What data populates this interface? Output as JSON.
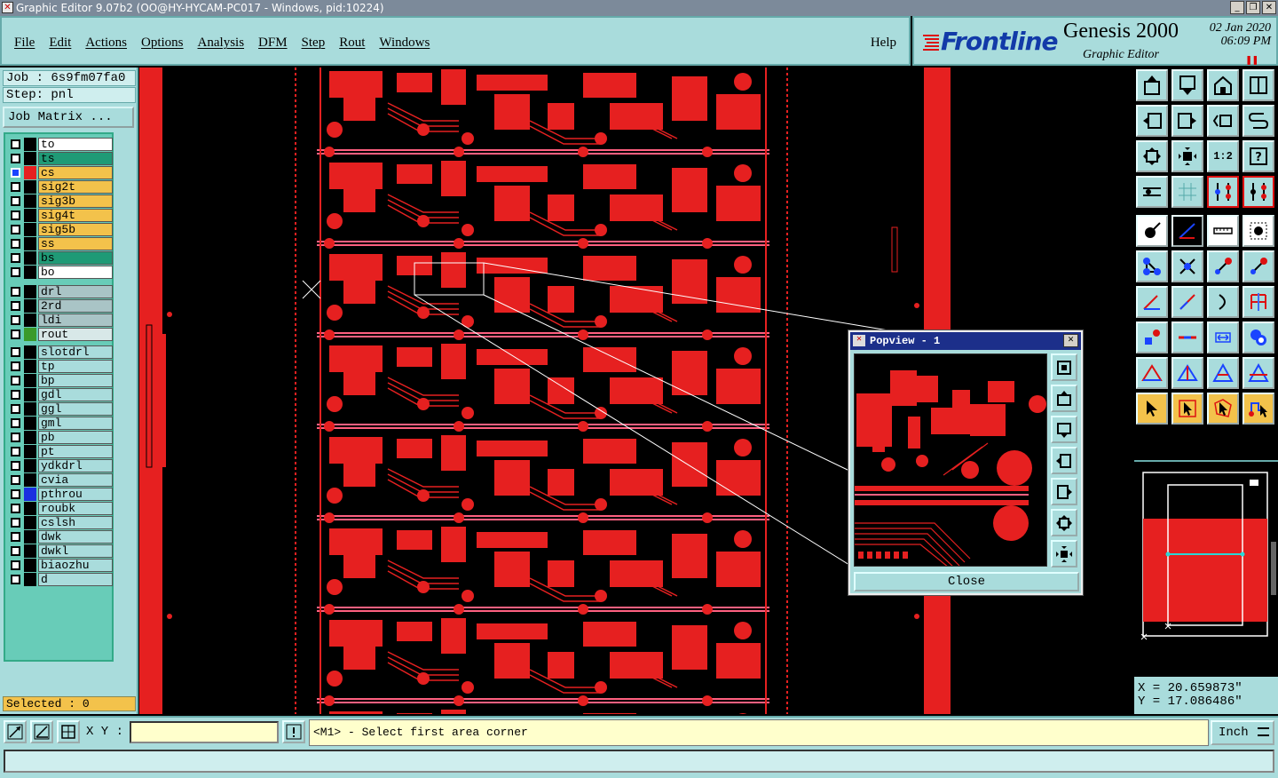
{
  "window": {
    "title": "Graphic Editor 9.07b2 (OO@HY-HYCAM-PC017 - Windows, pid:10224)"
  },
  "menu": {
    "items": [
      "File",
      "Edit",
      "Actions",
      "Options",
      "Analysis",
      "DFM",
      "Step",
      "Rout",
      "Windows"
    ],
    "help": "Help"
  },
  "brand": {
    "logo": "Frontline",
    "product": "Genesis 2000",
    "subtitle": "Graphic Editor",
    "date": "02 Jan 2020",
    "time": "06:09 PM"
  },
  "job": {
    "job_label": "Job : 6s9fm07fa0",
    "step_label": "Step: pnl",
    "job_matrix_button": "Job Matrix ..."
  },
  "layers": [
    {
      "name": "to",
      "color": "#ffffff",
      "swatch": "#000000"
    },
    {
      "name": "ts",
      "color": "#1f9a76",
      "swatch": "#000000"
    },
    {
      "name": "cs",
      "color": "#f3c24b",
      "swatch": "#e62020",
      "selected": true,
      "marker": "⊞"
    },
    {
      "name": "sig2t",
      "color": "#f3c24b",
      "swatch": "#000000"
    },
    {
      "name": "sig3b",
      "color": "#f3c24b",
      "swatch": "#000000"
    },
    {
      "name": "sig4t",
      "color": "#f3c24b",
      "swatch": "#000000"
    },
    {
      "name": "sig5b",
      "color": "#f3c24b",
      "swatch": "#000000"
    },
    {
      "name": "ss",
      "color": "#f3c24b",
      "swatch": "#000000"
    },
    {
      "name": "bs",
      "color": "#1f9a76",
      "swatch": "#000000"
    },
    {
      "name": "bo",
      "color": "#ffffff",
      "swatch": "#000000"
    },
    {
      "name": "drl",
      "color": "#a9c4c6",
      "swatch": "#000000"
    },
    {
      "name": "2rd",
      "color": "#a9c4c6",
      "swatch": "#000000"
    },
    {
      "name": "ldi",
      "color": "#a9c4c6",
      "swatch": "#000000"
    },
    {
      "name": "rout",
      "color": "#d8e8e8",
      "swatch": "#3a9a2a"
    },
    {
      "name": "slotdrl",
      "color": "#a9dcdc",
      "swatch": "#000000"
    },
    {
      "name": "tp",
      "color": "#a9dcdc",
      "swatch": "#000000"
    },
    {
      "name": "bp",
      "color": "#a9dcdc",
      "swatch": "#000000"
    },
    {
      "name": "gdl",
      "color": "#a9dcdc",
      "swatch": "#000000"
    },
    {
      "name": "ggl",
      "color": "#a9dcdc",
      "swatch": "#000000"
    },
    {
      "name": "gml",
      "color": "#a9dcdc",
      "swatch": "#000000"
    },
    {
      "name": "pb",
      "color": "#a9dcdc",
      "swatch": "#000000"
    },
    {
      "name": "pt",
      "color": "#a9dcdc",
      "swatch": "#000000"
    },
    {
      "name": "ydkdrl",
      "color": "#a9dcdc",
      "swatch": "#000000"
    },
    {
      "name": "cvia",
      "color": "#a9dcdc",
      "swatch": "#000000"
    },
    {
      "name": "pthrou",
      "color": "#a9dcdc",
      "swatch": "#1a30e0"
    },
    {
      "name": "roubk",
      "color": "#a9dcdc",
      "swatch": "#000000"
    },
    {
      "name": "cslsh",
      "color": "#a9dcdc",
      "swatch": "#000000"
    },
    {
      "name": "dwk",
      "color": "#a9dcdc",
      "swatch": "#000000"
    },
    {
      "name": "dwkl",
      "color": "#a9dcdc",
      "swatch": "#000000"
    },
    {
      "name": "biaozhu",
      "color": "#a9dcdc",
      "swatch": "#000000"
    },
    {
      "name": "d",
      "color": "#a9dcdc",
      "swatch": "#000000"
    }
  ],
  "status": {
    "selected": "Selected : 0"
  },
  "popview": {
    "title": "Popview - 1",
    "close_button": "Close"
  },
  "coords": {
    "x": "X = 20.659873\"",
    "y": "Y = 17.086486\""
  },
  "bottom": {
    "xy_label": "X Y :",
    "xy_value": "",
    "prompt": "<M1> - Select first area corner",
    "unit": "Inch"
  },
  "colors": {
    "panel": "#a9dcdc",
    "copper": "#e62020",
    "accent": "#1c2f8a"
  }
}
